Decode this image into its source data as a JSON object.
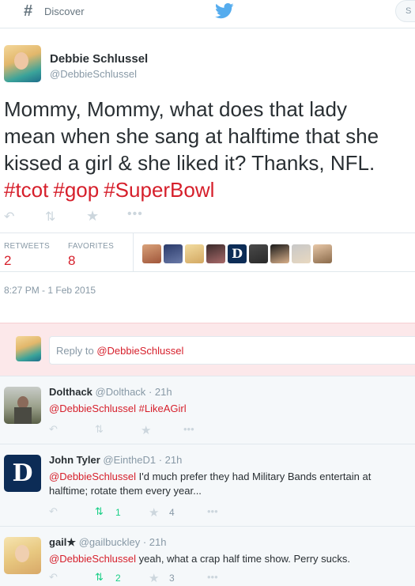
{
  "topbar": {
    "discover_label": "Discover",
    "search_placeholder": "S"
  },
  "tweet": {
    "author_name": "Debbie Schlussel",
    "author_handle": "@DebbieSchlussel",
    "text": "Mommy, Mommy, what does that lady\nmean when she sang at halftime that she\nkissed a girl & she liked it? Thanks, NFL.",
    "hashtags": [
      "#tcot",
      "#gop",
      "#SuperBowl"
    ],
    "retweets_label": "RETWEETS",
    "retweets_count": "2",
    "favorites_label": "FAVORITES",
    "favorites_count": "8",
    "timestamp": "8:27 PM - 1 Feb 2015"
  },
  "reply_box": {
    "placeholder_prefix": "Reply to ",
    "mention": "@DebbieSchlussel"
  },
  "replies": [
    {
      "name": "Dolthack",
      "handle": "@Dolthack",
      "time": "· 21h",
      "mention": "@DebbieSchlussel",
      "text": " #LikeAGirl",
      "retweets": "",
      "favorites": ""
    },
    {
      "name": "John Tyler",
      "handle": "@EintheD1",
      "time": "· 21h",
      "mention": "@DebbieSchlussel",
      "text": " I'd much prefer they had Military Bands entertain at halftime; rotate them every year...",
      "retweets": "1",
      "favorites": "4"
    },
    {
      "name": "gail★",
      "handle": "@gailbuckley",
      "time": "· 21h",
      "mention": "@DebbieSchlussel",
      "text": " yeah, what a crap half time show. Perry sucks.",
      "retweets": "2",
      "favorites": "3"
    }
  ],
  "colors": {
    "accent": "#d61f2b",
    "retweeted": "#19cf86",
    "muted": "#8899a6"
  }
}
